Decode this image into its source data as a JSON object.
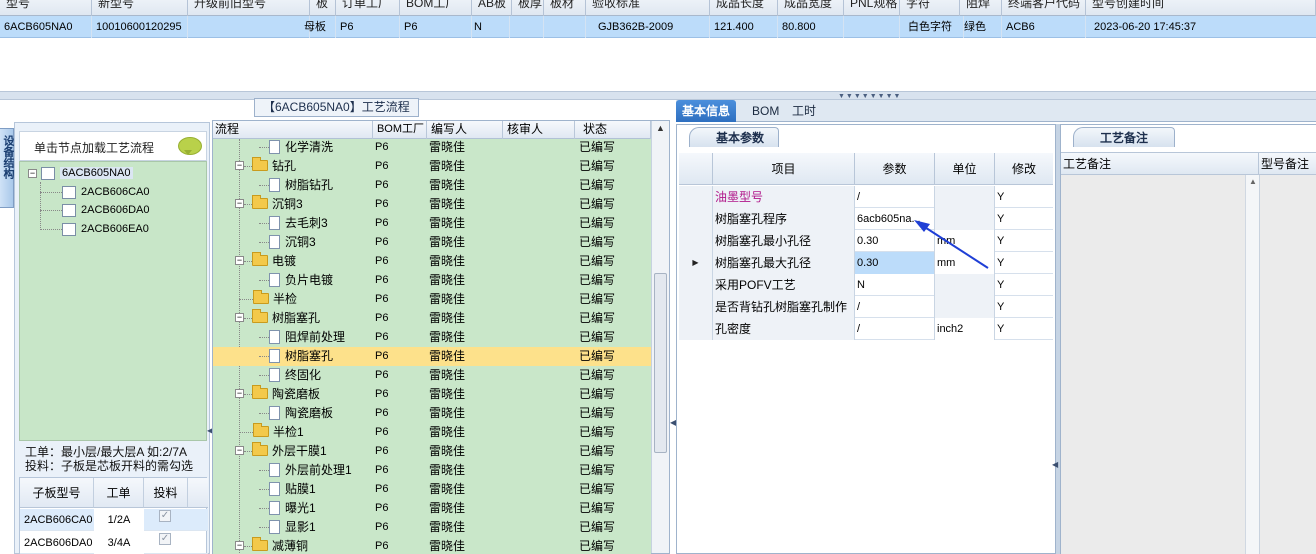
{
  "top_grid": {
    "columns": [
      "型号",
      "新型号",
      "升级前旧型号",
      "板",
      "订单工厂",
      "BOM工厂",
      "AB板",
      "板厚",
      "板材",
      "验收标准",
      "成品长度",
      "成品宽度",
      "PNL规格",
      "字符",
      "阻焊",
      "终端客户代码",
      "型号创建时间"
    ],
    "row": [
      "6ACB605NA0",
      "10010600120295",
      "",
      "母板",
      "P6",
      "P6",
      "N",
      "",
      "",
      "GJB362B-2009",
      "121.400",
      "80.800",
      "",
      "白色字符",
      "绿色",
      "ACB6",
      "2023-06-20 17:45:37"
    ]
  },
  "left_tab": "设备结构",
  "left_panel": {
    "hint": "单击节点加载工艺流程",
    "tree": {
      "root": "6ACB605NA0",
      "children": [
        "2ACB606CA0",
        "2ACB606DA0",
        "2ACB606EA0"
      ]
    },
    "note_line1": "工单：最小层/最大层A 如:2/7A",
    "note_line2": "投料：子板是芯板开料的需勾选",
    "sub_grid": {
      "headers": [
        "子板型号",
        "工单",
        "投料"
      ],
      "rows": [
        {
          "model": "2ACB606CA0",
          "order": "1/2A",
          "feed": "✓"
        },
        {
          "model": "2ACB606DA0",
          "order": "3/4A",
          "feed": "✓"
        }
      ]
    }
  },
  "process_panel": {
    "title": "【6ACB605NA0】工艺流程",
    "headers": [
      "流程",
      "BOM工厂",
      "编写人",
      "核审人",
      "状态"
    ],
    "rows": [
      {
        "name": "化学清洗",
        "type": "child",
        "bom": "P6",
        "writer": "雷晓佳",
        "status": "已编写"
      },
      {
        "name": "钻孔",
        "type": "group",
        "bom": "P6",
        "writer": "雷晓佳",
        "status": "已编写"
      },
      {
        "name": "树脂钻孔",
        "type": "child",
        "bom": "P6",
        "writer": "雷晓佳",
        "status": "已编写"
      },
      {
        "name": "沉铜3",
        "type": "group",
        "bom": "P6",
        "writer": "雷晓佳",
        "status": "已编写"
      },
      {
        "name": "去毛刺3",
        "type": "child",
        "bom": "P6",
        "writer": "雷晓佳",
        "status": "已编写"
      },
      {
        "name": "沉铜3",
        "type": "child",
        "bom": "P6",
        "writer": "雷晓佳",
        "status": "已编写"
      },
      {
        "name": "电镀",
        "type": "group",
        "bom": "P6",
        "writer": "雷晓佳",
        "status": "已编写"
      },
      {
        "name": "负片电镀",
        "type": "child",
        "bom": "P6",
        "writer": "雷晓佳",
        "status": "已编写"
      },
      {
        "name": "半检",
        "type": "leaf",
        "bom": "P6",
        "writer": "雷晓佳",
        "status": "已编写"
      },
      {
        "name": "树脂塞孔",
        "type": "group",
        "bom": "P6",
        "writer": "雷晓佳",
        "status": "已编写"
      },
      {
        "name": "阻焊前处理",
        "type": "child",
        "bom": "P6",
        "writer": "雷晓佳",
        "status": "已编写"
      },
      {
        "name": "树脂塞孔",
        "type": "child",
        "bom": "P6",
        "writer": "雷晓佳",
        "status": "已编写",
        "highlight": true
      },
      {
        "name": "终固化",
        "type": "child",
        "bom": "P6",
        "writer": "雷晓佳",
        "status": "已编写"
      },
      {
        "name": "陶瓷磨板",
        "type": "group",
        "bom": "P6",
        "writer": "雷晓佳",
        "status": "已编写"
      },
      {
        "name": "陶瓷磨板",
        "type": "child",
        "bom": "P6",
        "writer": "雷晓佳",
        "status": "已编写"
      },
      {
        "name": "半检1",
        "type": "leaf",
        "bom": "P6",
        "writer": "雷晓佳",
        "status": "已编写"
      },
      {
        "name": "外层干膜1",
        "type": "group",
        "bom": "P6",
        "writer": "雷晓佳",
        "status": "已编写"
      },
      {
        "name": "外层前处理1",
        "type": "child",
        "bom": "P6",
        "writer": "雷晓佳",
        "status": "已编写"
      },
      {
        "name": "贴膜1",
        "type": "child",
        "bom": "P6",
        "writer": "雷晓佳",
        "status": "已编写"
      },
      {
        "name": "曝光1",
        "type": "child",
        "bom": "P6",
        "writer": "雷晓佳",
        "status": "已编写"
      },
      {
        "name": "显影1",
        "type": "child",
        "bom": "P6",
        "writer": "雷晓佳",
        "status": "已编写"
      },
      {
        "name": "减薄铜",
        "type": "group",
        "bom": "P6",
        "writer": "雷晓佳",
        "status": "已编写"
      }
    ]
  },
  "right_tabs": [
    "基本信息",
    "BOM",
    "工时"
  ],
  "basic_panel": {
    "title": "基本参数",
    "headers": [
      "项目",
      "参数",
      "单位",
      "修改"
    ],
    "rows": [
      {
        "item": "油墨型号",
        "param": "/",
        "unit": "",
        "mod": "Y",
        "item_color": "#b0178a"
      },
      {
        "item": "树脂塞孔程序",
        "param": "6acb605na...",
        "unit": "",
        "mod": "Y"
      },
      {
        "item": "树脂塞孔最小孔径",
        "param": "0.30",
        "unit": "mm",
        "mod": "Y"
      },
      {
        "item": "树脂塞孔最大孔径",
        "param": "0.30",
        "unit": "mm",
        "mod": "Y",
        "current": true
      },
      {
        "item": "采用POFV工艺",
        "param": "N",
        "unit": "",
        "mod": "Y"
      },
      {
        "item": "是否背钻孔树脂塞孔制作",
        "param": "/",
        "unit": "",
        "mod": "Y"
      },
      {
        "item": "孔密度",
        "param": "/",
        "unit": "inch2",
        "mod": "Y"
      }
    ],
    "row_indicator": "▶"
  },
  "remark_panel": {
    "title": "工艺备注",
    "headers": [
      "工艺备注",
      "型号备注"
    ]
  },
  "colors": {
    "accent": "#2e6fc0",
    "tree_bg": "#c9e7c9",
    "highlight": "#fde18b",
    "selection": "#bcdcfa",
    "arrow": "#1f3fd6"
  }
}
